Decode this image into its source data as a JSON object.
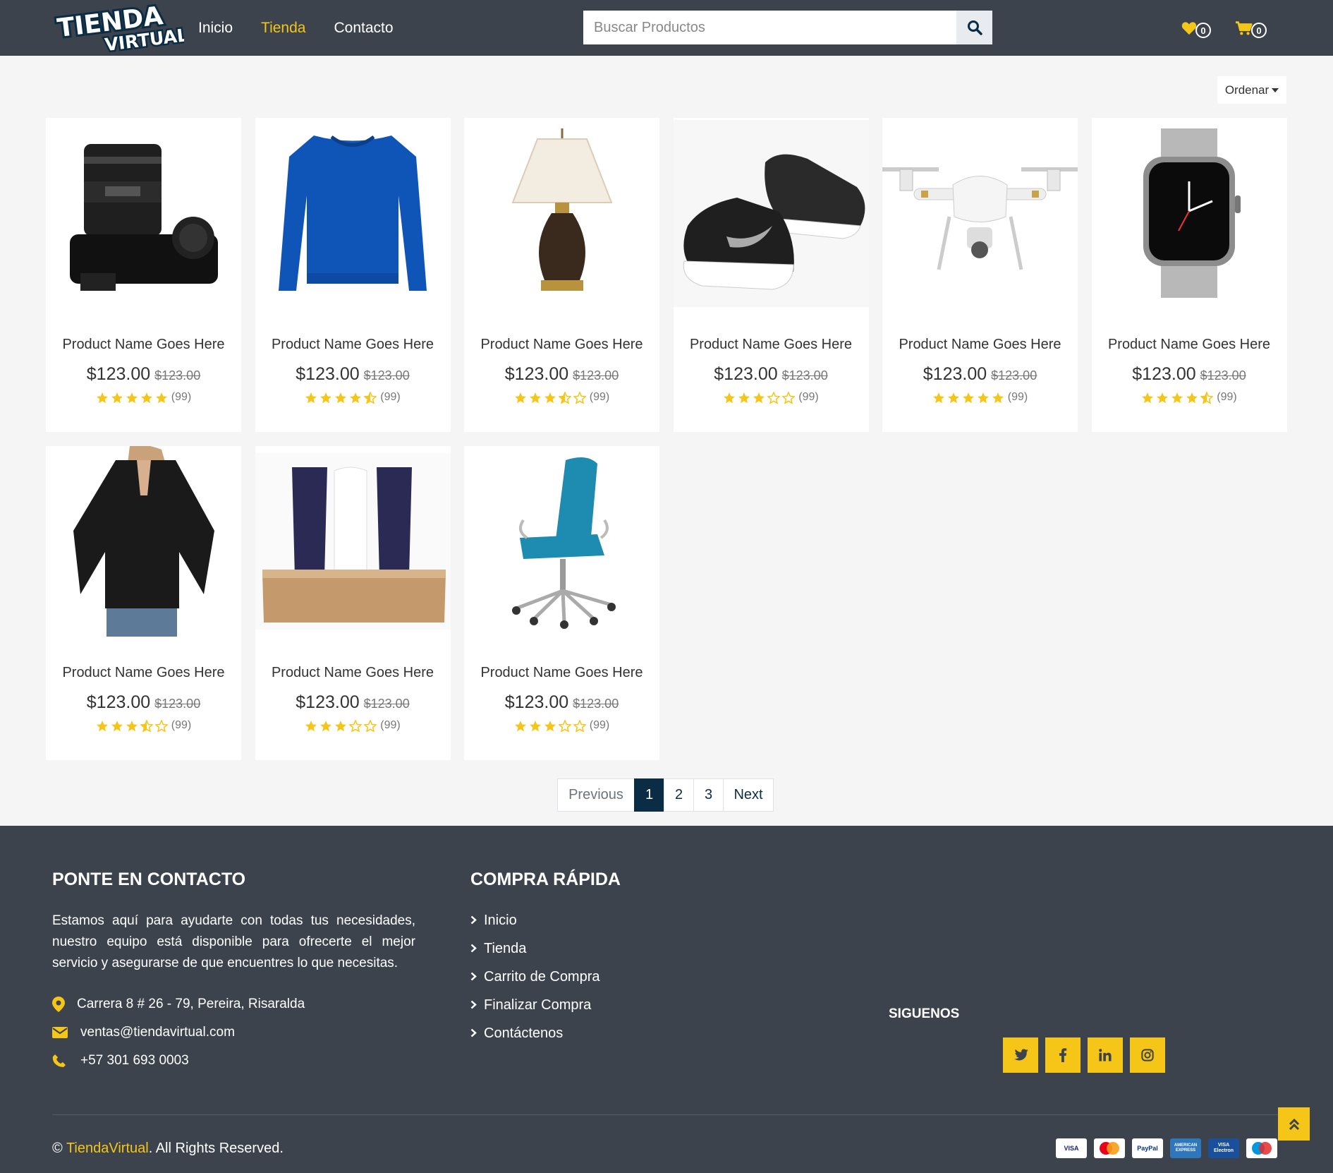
{
  "brand": {
    "line1": "TIENDA",
    "line2": "VIRTUAL"
  },
  "nav": [
    {
      "label": "Inicio",
      "active": false
    },
    {
      "label": "Tienda",
      "active": true
    },
    {
      "label": "Contacto",
      "active": false
    }
  ],
  "search": {
    "placeholder": "Buscar Productos",
    "icon": "search-icon"
  },
  "header": {
    "wishlist_count": "0",
    "cart_count": "0",
    "wishlist_icon": "heart-icon",
    "cart_icon": "cart-icon"
  },
  "sort": {
    "label": "Ordenar"
  },
  "products": [
    {
      "name": "Product Name Goes Here",
      "price": "$123.00",
      "old_price": "$123.00",
      "rating": 5,
      "reviews": "(99)",
      "image": "camera"
    },
    {
      "name": "Product Name Goes Here",
      "price": "$123.00",
      "old_price": "$123.00",
      "rating": 4.5,
      "reviews": "(99)",
      "image": "sweater"
    },
    {
      "name": "Product Name Goes Here",
      "price": "$123.00",
      "old_price": "$123.00",
      "rating": 3.5,
      "reviews": "(99)",
      "image": "lamp"
    },
    {
      "name": "Product Name Goes Here",
      "price": "$123.00",
      "old_price": "$123.00",
      "rating": 3,
      "reviews": "(99)",
      "image": "shoes"
    },
    {
      "name": "Product Name Goes Here",
      "price": "$123.00",
      "old_price": "$123.00",
      "rating": 5,
      "reviews": "(99)",
      "image": "drone"
    },
    {
      "name": "Product Name Goes Here",
      "price": "$123.00",
      "old_price": "$123.00",
      "rating": 4.5,
      "reviews": "(99)",
      "image": "watch"
    },
    {
      "name": "Product Name Goes Here",
      "price": "$123.00",
      "old_price": "$123.00",
      "rating": 3.5,
      "reviews": "(99)",
      "image": "blouse"
    },
    {
      "name": "Product Name Goes Here",
      "price": "$123.00",
      "old_price": "$123.00",
      "rating": 3,
      "reviews": "(99)",
      "image": "cosmetics"
    },
    {
      "name": "Product Name Goes Here",
      "price": "$123.00",
      "old_price": "$123.00",
      "rating": 3,
      "reviews": "(99)",
      "image": "chair"
    }
  ],
  "pagination": {
    "previous": "Previous",
    "pages": [
      "1",
      "2",
      "3"
    ],
    "current": "1",
    "next": "Next"
  },
  "footer": {
    "contact_title": "PONTE EN CONTACTO",
    "description": "Estamos aquí para ayudarte con todas tus necesidades, nuestro equipo está disponible para ofrecerte el mejor servicio y asegurarse de que encuentres lo que necesitas.",
    "address": "Carrera 8 # 26 - 79, Pereira, Risaralda",
    "email": "ventas@tiendavirtual.com",
    "phone": "+57 301 693 0003",
    "quick_title": "COMPRA RÁPIDA",
    "quick_links": [
      "Inicio",
      "Tienda",
      "Carrito de Compra",
      "Finalizar Compra",
      "Contáctenos"
    ],
    "follow_title": "SIGUENOS",
    "social": [
      "twitter-icon",
      "facebook-icon",
      "linkedin-icon",
      "instagram-icon"
    ],
    "copyright_prefix": "©",
    "copyright_brand": "TiendaVirtual",
    "copyright_suffix": ". All Rights Reserved.",
    "payment_cards": [
      "VISA",
      "MasterCard",
      "PayPal",
      "AMERICAN EXPRESS",
      "VISA Electron",
      "Maestro"
    ]
  },
  "colors": {
    "accent": "#f5c518",
    "header_bg": "#3c434c",
    "page_bg": "#f5f5f5",
    "primary": "#0b2c45"
  }
}
